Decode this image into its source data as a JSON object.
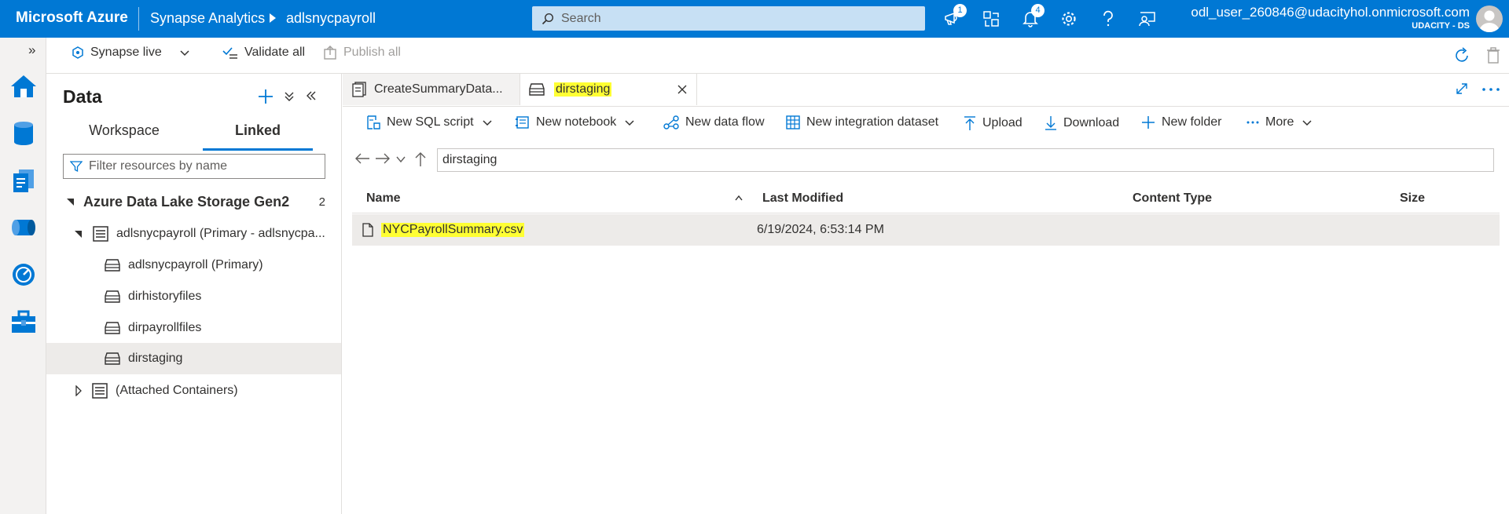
{
  "topbar": {
    "brand": "Microsoft Azure",
    "app": "Synapse Analytics",
    "workspace": "adlsnycpayroll",
    "search_placeholder": "Search",
    "notifications_badge": "1",
    "alerts_badge": "4",
    "user_name": "odl_user_260846@udacityhol.onmicrosoft.com",
    "user_org": "UDACITY - DS"
  },
  "rail": {
    "expand_label": "»",
    "items": [
      "home-icon",
      "data-icon",
      "develop-icon",
      "integrate-icon",
      "monitor-icon",
      "manage-icon"
    ]
  },
  "cmdbar": {
    "live_label": "Synapse live",
    "validate_label": "Validate all",
    "publish_label": "Publish all"
  },
  "data_panel": {
    "title": "Data",
    "tabs": [
      {
        "label": "Workspace",
        "active": false
      },
      {
        "label": "Linked",
        "active": true
      }
    ],
    "filter_placeholder": "Filter resources by name",
    "group": {
      "label": "Azure Data Lake Storage Gen2",
      "count": "2"
    },
    "account": "adlsnycpayroll (Primary - adlsnycpa...",
    "containers": [
      {
        "label": "adlsnycpayroll (Primary)",
        "selected": false
      },
      {
        "label": "dirhistoryfiles",
        "selected": false
      },
      {
        "label": "dirpayrollfiles",
        "selected": false
      },
      {
        "label": "dirstaging",
        "selected": true
      }
    ],
    "attached": "(Attached Containers)"
  },
  "doc_tabs": [
    {
      "label": "CreateSummaryData...",
      "active": false
    },
    {
      "label": "dirstaging",
      "active": true
    }
  ],
  "toolbar": {
    "new_sql_script": "New SQL script",
    "new_notebook": "New notebook",
    "new_data_flow": "New data flow",
    "new_integration_dataset": "New integration dataset",
    "upload": "Upload",
    "download": "Download",
    "new_folder": "New folder",
    "more": "More"
  },
  "path": "dirstaging",
  "grid": {
    "columns": [
      "Name",
      "Last Modified",
      "Content Type",
      "Size"
    ],
    "rows": [
      {
        "name": "NYCPayrollSummary.csv",
        "last_modified": "6/19/2024, 6:53:14 PM",
        "content_type": "",
        "size": ""
      }
    ]
  },
  "colors": {
    "azure_blue": "#0078d4",
    "highlight": "#ffff33"
  }
}
